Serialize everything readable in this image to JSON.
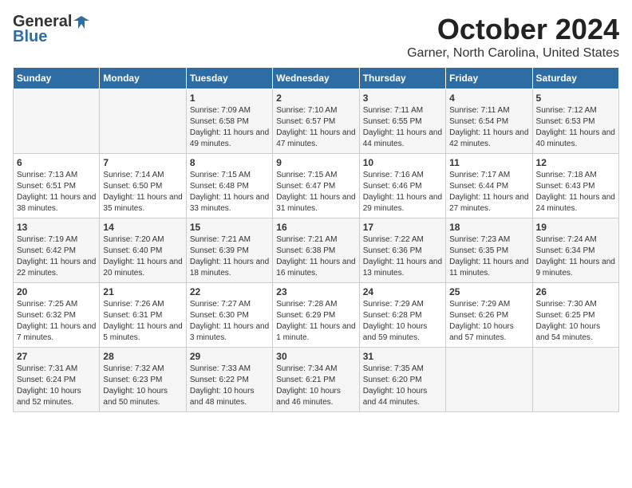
{
  "header": {
    "logo_general": "General",
    "logo_blue": "Blue",
    "month": "October 2024",
    "location": "Garner, North Carolina, United States"
  },
  "weekdays": [
    "Sunday",
    "Monday",
    "Tuesday",
    "Wednesday",
    "Thursday",
    "Friday",
    "Saturday"
  ],
  "weeks": [
    [
      {
        "day": "",
        "info": ""
      },
      {
        "day": "",
        "info": ""
      },
      {
        "day": "1",
        "info": "Sunrise: 7:09 AM\nSunset: 6:58 PM\nDaylight: 11 hours and 49 minutes."
      },
      {
        "day": "2",
        "info": "Sunrise: 7:10 AM\nSunset: 6:57 PM\nDaylight: 11 hours and 47 minutes."
      },
      {
        "day": "3",
        "info": "Sunrise: 7:11 AM\nSunset: 6:55 PM\nDaylight: 11 hours and 44 minutes."
      },
      {
        "day": "4",
        "info": "Sunrise: 7:11 AM\nSunset: 6:54 PM\nDaylight: 11 hours and 42 minutes."
      },
      {
        "day": "5",
        "info": "Sunrise: 7:12 AM\nSunset: 6:53 PM\nDaylight: 11 hours and 40 minutes."
      }
    ],
    [
      {
        "day": "6",
        "info": "Sunrise: 7:13 AM\nSunset: 6:51 PM\nDaylight: 11 hours and 38 minutes."
      },
      {
        "day": "7",
        "info": "Sunrise: 7:14 AM\nSunset: 6:50 PM\nDaylight: 11 hours and 35 minutes."
      },
      {
        "day": "8",
        "info": "Sunrise: 7:15 AM\nSunset: 6:48 PM\nDaylight: 11 hours and 33 minutes."
      },
      {
        "day": "9",
        "info": "Sunrise: 7:15 AM\nSunset: 6:47 PM\nDaylight: 11 hours and 31 minutes."
      },
      {
        "day": "10",
        "info": "Sunrise: 7:16 AM\nSunset: 6:46 PM\nDaylight: 11 hours and 29 minutes."
      },
      {
        "day": "11",
        "info": "Sunrise: 7:17 AM\nSunset: 6:44 PM\nDaylight: 11 hours and 27 minutes."
      },
      {
        "day": "12",
        "info": "Sunrise: 7:18 AM\nSunset: 6:43 PM\nDaylight: 11 hours and 24 minutes."
      }
    ],
    [
      {
        "day": "13",
        "info": "Sunrise: 7:19 AM\nSunset: 6:42 PM\nDaylight: 11 hours and 22 minutes."
      },
      {
        "day": "14",
        "info": "Sunrise: 7:20 AM\nSunset: 6:40 PM\nDaylight: 11 hours and 20 minutes."
      },
      {
        "day": "15",
        "info": "Sunrise: 7:21 AM\nSunset: 6:39 PM\nDaylight: 11 hours and 18 minutes."
      },
      {
        "day": "16",
        "info": "Sunrise: 7:21 AM\nSunset: 6:38 PM\nDaylight: 11 hours and 16 minutes."
      },
      {
        "day": "17",
        "info": "Sunrise: 7:22 AM\nSunset: 6:36 PM\nDaylight: 11 hours and 13 minutes."
      },
      {
        "day": "18",
        "info": "Sunrise: 7:23 AM\nSunset: 6:35 PM\nDaylight: 11 hours and 11 minutes."
      },
      {
        "day": "19",
        "info": "Sunrise: 7:24 AM\nSunset: 6:34 PM\nDaylight: 11 hours and 9 minutes."
      }
    ],
    [
      {
        "day": "20",
        "info": "Sunrise: 7:25 AM\nSunset: 6:32 PM\nDaylight: 11 hours and 7 minutes."
      },
      {
        "day": "21",
        "info": "Sunrise: 7:26 AM\nSunset: 6:31 PM\nDaylight: 11 hours and 5 minutes."
      },
      {
        "day": "22",
        "info": "Sunrise: 7:27 AM\nSunset: 6:30 PM\nDaylight: 11 hours and 3 minutes."
      },
      {
        "day": "23",
        "info": "Sunrise: 7:28 AM\nSunset: 6:29 PM\nDaylight: 11 hours and 1 minute."
      },
      {
        "day": "24",
        "info": "Sunrise: 7:29 AM\nSunset: 6:28 PM\nDaylight: 10 hours and 59 minutes."
      },
      {
        "day": "25",
        "info": "Sunrise: 7:29 AM\nSunset: 6:26 PM\nDaylight: 10 hours and 57 minutes."
      },
      {
        "day": "26",
        "info": "Sunrise: 7:30 AM\nSunset: 6:25 PM\nDaylight: 10 hours and 54 minutes."
      }
    ],
    [
      {
        "day": "27",
        "info": "Sunrise: 7:31 AM\nSunset: 6:24 PM\nDaylight: 10 hours and 52 minutes."
      },
      {
        "day": "28",
        "info": "Sunrise: 7:32 AM\nSunset: 6:23 PM\nDaylight: 10 hours and 50 minutes."
      },
      {
        "day": "29",
        "info": "Sunrise: 7:33 AM\nSunset: 6:22 PM\nDaylight: 10 hours and 48 minutes."
      },
      {
        "day": "30",
        "info": "Sunrise: 7:34 AM\nSunset: 6:21 PM\nDaylight: 10 hours and 46 minutes."
      },
      {
        "day": "31",
        "info": "Sunrise: 7:35 AM\nSunset: 6:20 PM\nDaylight: 10 hours and 44 minutes."
      },
      {
        "day": "",
        "info": ""
      },
      {
        "day": "",
        "info": ""
      }
    ]
  ]
}
